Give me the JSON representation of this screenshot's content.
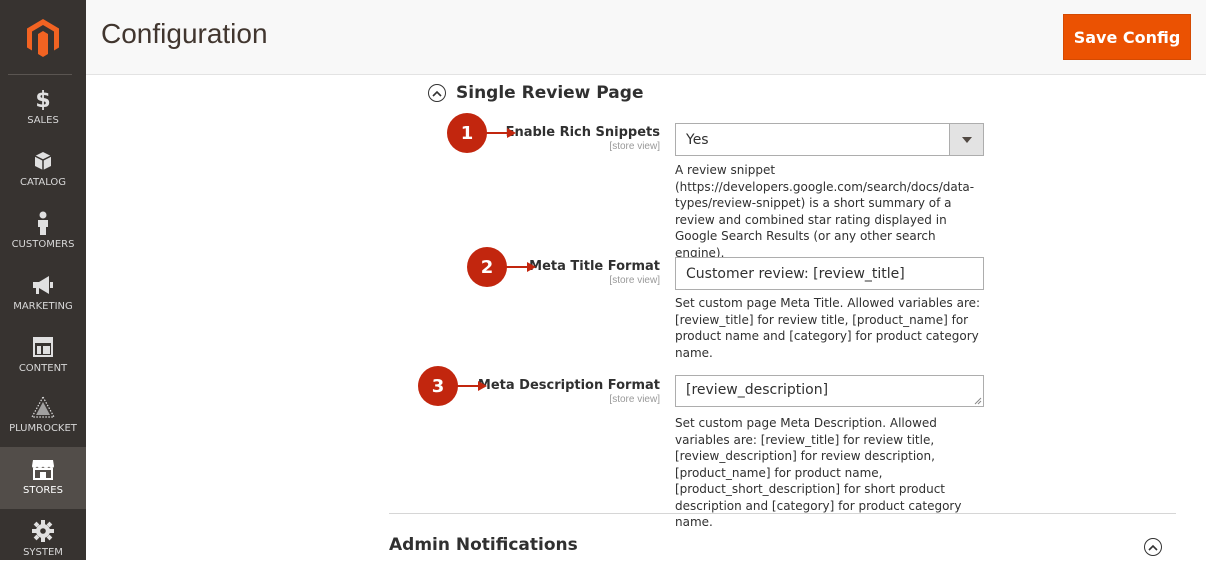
{
  "app": {
    "page_title": "Configuration",
    "save_label": "Save Config",
    "accent": "#eb5202"
  },
  "sidebar": {
    "items": [
      {
        "label": "SALES",
        "icon": "dollar-icon"
      },
      {
        "label": "CATALOG",
        "icon": "cube-icon"
      },
      {
        "label": "CUSTOMERS",
        "icon": "person-icon"
      },
      {
        "label": "MARKETING",
        "icon": "megaphone-icon"
      },
      {
        "label": "CONTENT",
        "icon": "layout-icon"
      },
      {
        "label": "PLUMROCKET",
        "icon": "plumrocket-icon"
      },
      {
        "label": "STORES",
        "icon": "store-icon",
        "active": true
      },
      {
        "label": "SYSTEM",
        "icon": "gear-icon"
      }
    ]
  },
  "section": {
    "title": "Single Review Page",
    "fields": [
      {
        "label": "Enable Rich Snippets",
        "scope": "[store view]",
        "value": "Yes",
        "note": "A review snippet (https://developers.google.com/search/docs/data-types/review-snippet) is a short summary of a review and combined star rating displayed in Google Search Results (or any other search engine).",
        "callout": "1"
      },
      {
        "label": "Meta Title Format",
        "scope": "[store view]",
        "value": "Customer review: [review_title]",
        "note": "Set custom page Meta Title. Allowed variables are: [review_title] for review title, [product_name] for product name and [category] for product category name.",
        "callout": "2"
      },
      {
        "label": "Meta Description Format",
        "scope": "[store view]",
        "value": "[review_description]",
        "note": "Set custom page Meta Description. Allowed variables are: [review_title] for review title, [review_description] for review description, [product_name] for product name, [product_short_description] for short product description and [category] for product category name.",
        "callout": "3"
      }
    ]
  },
  "next_section": {
    "title": "Admin Notifications"
  }
}
